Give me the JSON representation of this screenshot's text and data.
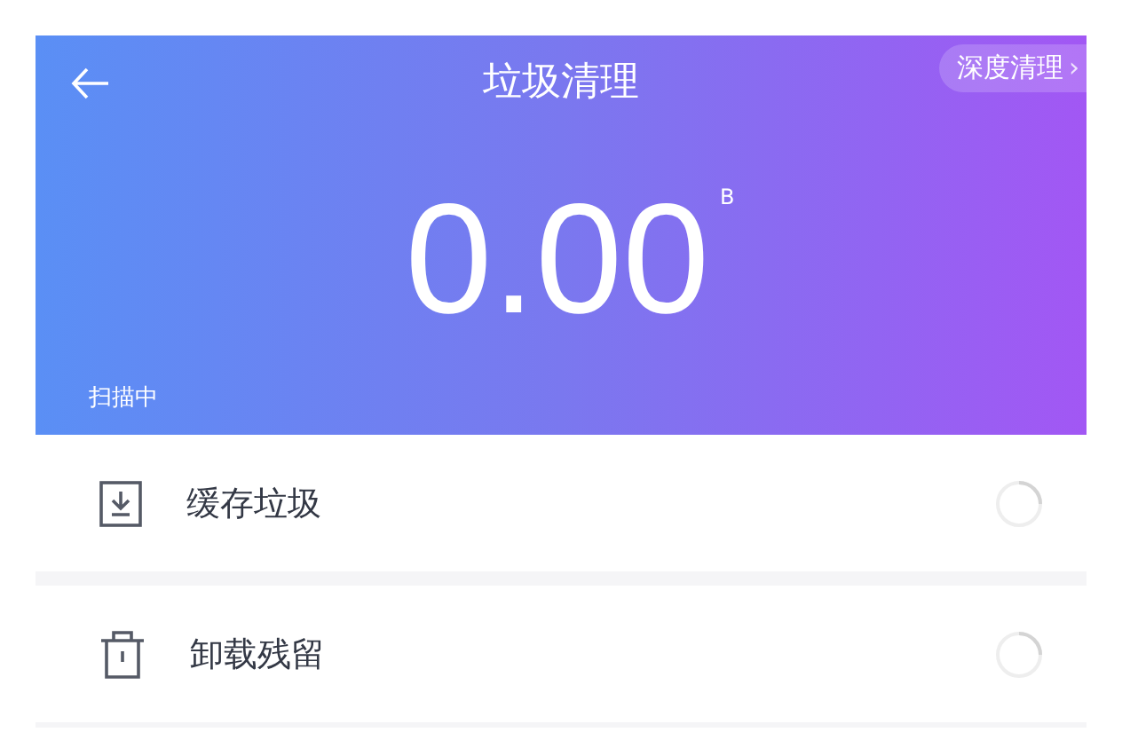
{
  "header": {
    "title": "垃圾清理",
    "deep_clean_button": "深度清理",
    "chevron": "›",
    "amount": "0.00",
    "unit": "B",
    "status": "扫描中"
  },
  "items": [
    {
      "kind": "cache",
      "label": "缓存垃圾",
      "loading": true
    },
    {
      "kind": "uninstall",
      "label": "卸载残留",
      "loading": true
    }
  ]
}
